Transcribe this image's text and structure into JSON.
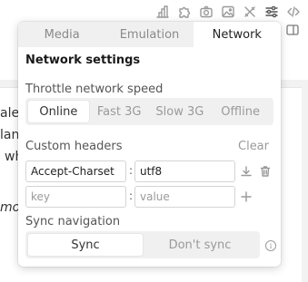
{
  "background": {
    "fragments": [
      "ale",
      "lan",
      "wh",
      "mon"
    ]
  },
  "toolbar": {
    "icons": [
      "chart-icon",
      "puzzle-icon",
      "camera-icon",
      "image-icon",
      "tools-icon",
      "sliders-icon",
      "code-icon"
    ],
    "status_dot_color": "#4a90d9"
  },
  "tabs": [
    "Media",
    "Emulation",
    "Network"
  ],
  "selected_tab": "Network",
  "title": "Network settings",
  "throttle": {
    "label": "Throttle network speed",
    "options": [
      "Online",
      "Fast 3G",
      "Slow 3G",
      "Offline"
    ],
    "selected": "Online"
  },
  "headers": {
    "label": "Custom headers",
    "clear_label": "Clear",
    "rows": [
      {
        "key": "Accept-Charset",
        "value": "utf8"
      }
    ],
    "new_key_placeholder": "key",
    "new_value_placeholder": "value",
    "separator": ":"
  },
  "sync": {
    "label": "Sync navigation",
    "options": [
      "Sync",
      "Don't sync"
    ],
    "selected": "Sync",
    "info_glyph": "i"
  }
}
